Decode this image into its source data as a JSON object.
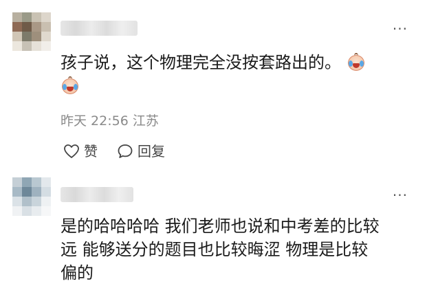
{
  "comments": [
    {
      "text": "孩子说，这个物理完全没按套路出的。",
      "emoji": "crying-face-emoji",
      "time": "昨天 22:56",
      "location": "江苏",
      "like_label": "赞",
      "reply_label": "回复",
      "more_label": "···"
    },
    {
      "text_line1": "是的哈哈哈哈 我们老师也说和中考差的比较",
      "text_line2": "远 能够送分的题目也比较晦涩 物理是比较",
      "text_line3": "偏的",
      "more_label": "···"
    }
  ]
}
